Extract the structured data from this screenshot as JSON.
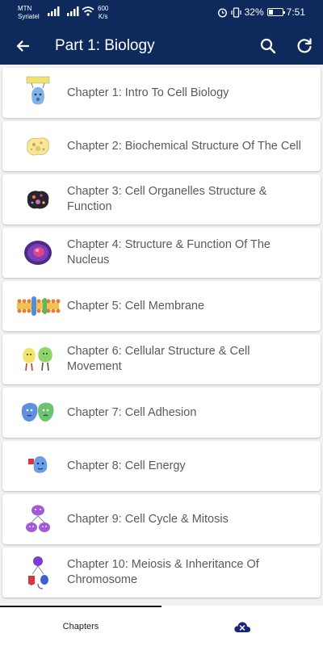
{
  "status_bar": {
    "carrier_line1": "MTN",
    "carrier_line2": "Syriatel",
    "speed_value": "600",
    "speed_unit": "K/s",
    "battery": "32%",
    "battery_level": 0.32,
    "time": "7:51"
  },
  "app_bar": {
    "title": "Part 1: Biology",
    "back_icon": "arrow-back-icon",
    "search_icon": "search-icon",
    "refresh_icon": "refresh-icon",
    "color": "#0e2a5c"
  },
  "chapters": [
    {
      "label": "Chapter 1: Intro To Cell Biology",
      "icon": "welcome-cell-icon"
    },
    {
      "label": "Chapter 2: Biochemical Structure Of The Cell",
      "icon": "biochemical-cell-icon"
    },
    {
      "label": "Chapter 3: Cell Organelles Structure & Function",
      "icon": "organelles-icon"
    },
    {
      "label": "Chapter 4: Structure & Function Of The Nucleus",
      "icon": "nucleus-icon"
    },
    {
      "label": "Chapter 5: Cell Membrane",
      "icon": "cell-membrane-icon"
    },
    {
      "label": "Chapter 6: Cellular Structure & Cell Movement",
      "icon": "cell-movement-icon"
    },
    {
      "label": "Chapter 7: Cell Adhesion",
      "icon": "cell-adhesion-icon"
    },
    {
      "label": "Chapter 8: Cell Energy",
      "icon": "cell-energy-icon"
    },
    {
      "label": "Chapter 9:  Cell Cycle & Mitosis",
      "icon": "mitosis-icon"
    },
    {
      "label": "Chapter 10: Meiosis & Inheritance Of Chromosome",
      "icon": "meiosis-icon"
    }
  ],
  "bottom_nav": {
    "chapters_label": "Chapters",
    "cloud_icon": "cloud-close-icon",
    "cloud_color": "#1a237e"
  }
}
